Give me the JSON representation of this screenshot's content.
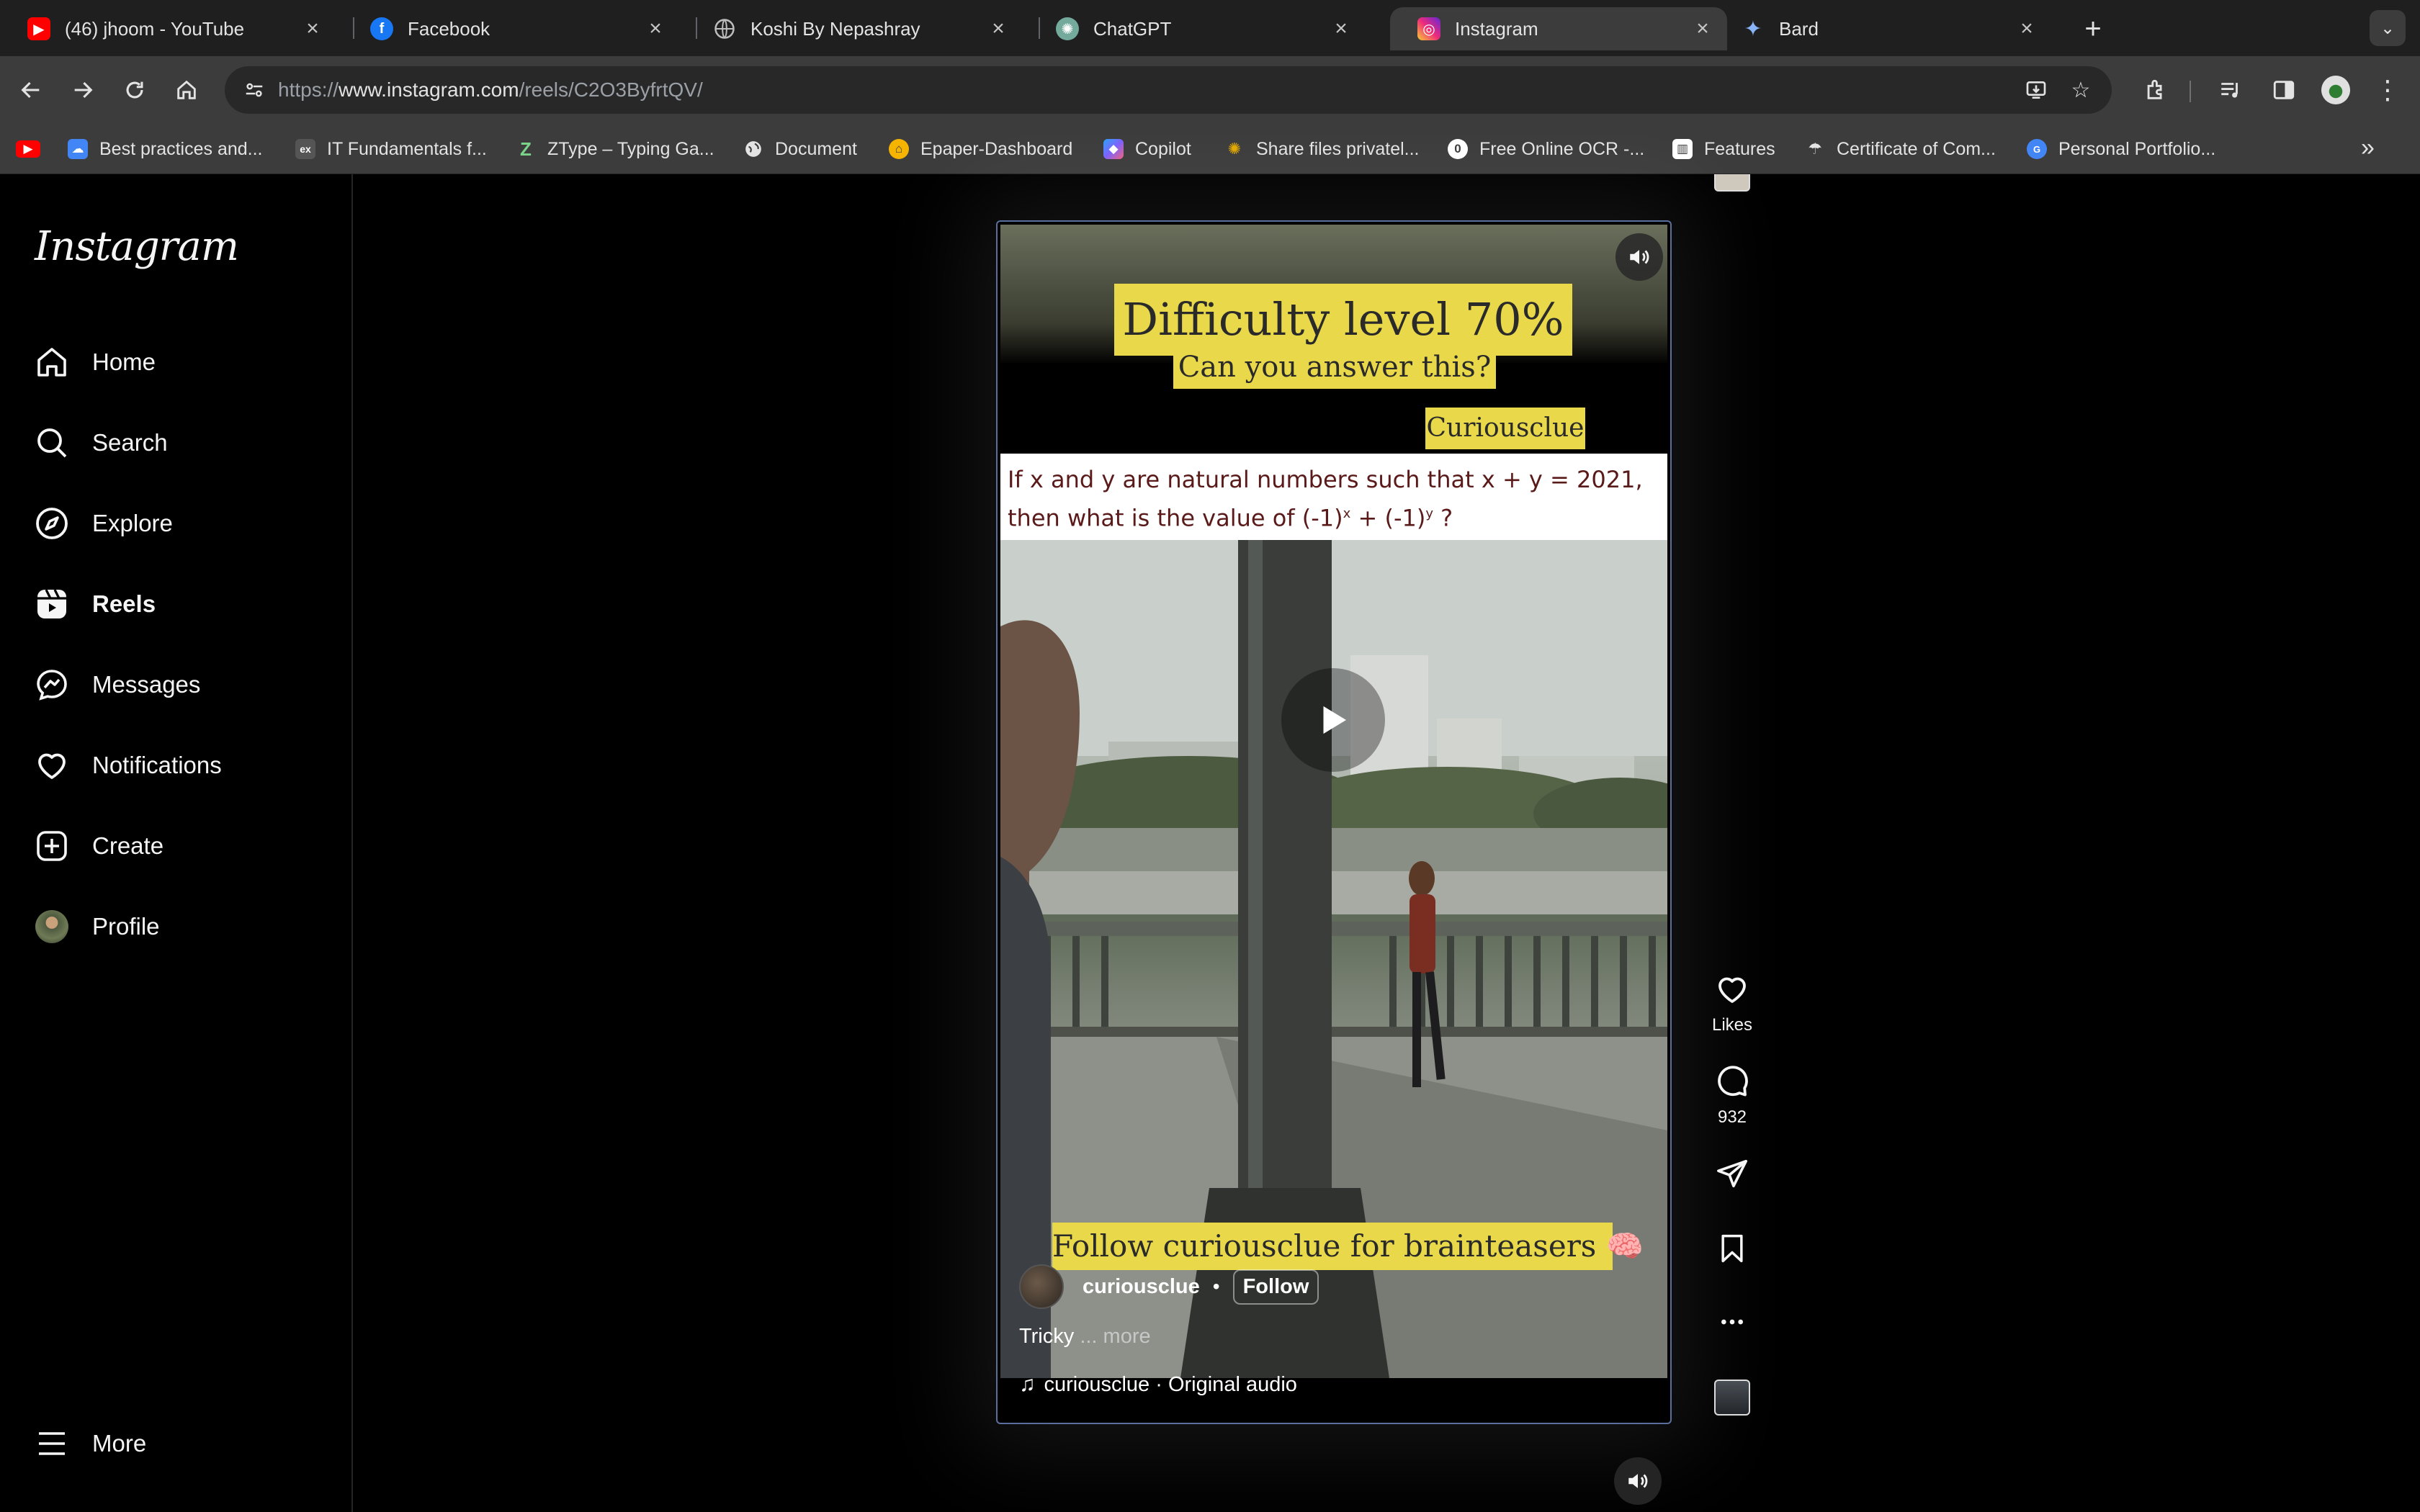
{
  "browser": {
    "tabs": [
      {
        "title": "(46) jhoom - YouTube",
        "favicon": "youtube-icon",
        "color": "#ff0000",
        "active": false
      },
      {
        "title": "Facebook",
        "favicon": "facebook-icon",
        "color": "#1877f2",
        "active": false
      },
      {
        "title": "Koshi By Nepashray",
        "favicon": "globe-icon",
        "color": "#8a8a8a",
        "active": false
      },
      {
        "title": "ChatGPT",
        "favicon": "chatgpt-icon",
        "color": "#74aa9c",
        "active": false
      },
      {
        "title": "Instagram",
        "favicon": "instagram-icon",
        "color": "#e1306c",
        "active": true
      },
      {
        "title": "Bard",
        "favicon": "bard-icon",
        "color": "#8ab4f8",
        "active": false
      }
    ],
    "url_prefix": "https://",
    "url_host": "www.instagram.com",
    "url_path": "/reels/C2O3ByfrtQV/",
    "bookmarks": [
      {
        "label": "Best practices and...",
        "icon": "google-cloud-icon",
        "color": "#4285f4"
      },
      {
        "label": "IT Fundamentals f...",
        "icon": "edx-icon",
        "color": "#555555"
      },
      {
        "label": "ZType – Typing Ga...",
        "icon": "ztype-icon",
        "color": "#3c3c3c"
      },
      {
        "label": "Document",
        "icon": "globe-icon",
        "color": "#3c3c3c"
      },
      {
        "label": "Epaper-Dashboard",
        "icon": "epaper-icon",
        "color": "#f5b400"
      },
      {
        "label": "Copilot",
        "icon": "copilot-icon",
        "color": "#7b61ff"
      },
      {
        "label": "Share files privatel...",
        "icon": "share-icon",
        "color": "#e0a800"
      },
      {
        "label": "Free Online OCR -...",
        "icon": "ocr-icon",
        "color": "#ffffff"
      },
      {
        "label": "Features",
        "icon": "features-icon",
        "color": "#ffffff"
      },
      {
        "label": "Certificate of Com...",
        "icon": "certificate-icon",
        "color": "#3c3c3c"
      },
      {
        "label": "Personal Portfolio...",
        "icon": "portfolio-icon",
        "color": "#4285f4"
      }
    ]
  },
  "instagram": {
    "logo": "Instagram",
    "nav": [
      {
        "label": "Home",
        "icon": "home-icon"
      },
      {
        "label": "Search",
        "icon": "search-icon"
      },
      {
        "label": "Explore",
        "icon": "explore-icon"
      },
      {
        "label": "Reels",
        "icon": "reels-icon"
      },
      {
        "label": "Messages",
        "icon": "messages-icon"
      },
      {
        "label": "Notifications",
        "icon": "heart-icon"
      },
      {
        "label": "Create",
        "icon": "create-icon"
      },
      {
        "label": "Profile",
        "icon": "avatar"
      }
    ],
    "more_label": "More"
  },
  "reel": {
    "difficulty": "Difficulty level 70%",
    "can_answer": "Can you answer this?",
    "brand_tag": "Curiousclue",
    "question_line1": "If x and y are natural numbers such that x + y = 2021,",
    "question_line2_a": "then what is the value of (-1)",
    "question_line2_b": "x",
    "question_line2_c": " + (-1)",
    "question_line2_d": "y",
    "question_line2_e": " ?",
    "follow_banner": "Follow curiousclue for brainteasers 🧠",
    "author": "curiousclue",
    "dot": "•",
    "follow": "Follow",
    "caption": "Tricky",
    "caption_more": "... more",
    "audio": "curiousclue · Original audio"
  },
  "actions": {
    "likes_label": "Likes",
    "comments_count": "932"
  }
}
